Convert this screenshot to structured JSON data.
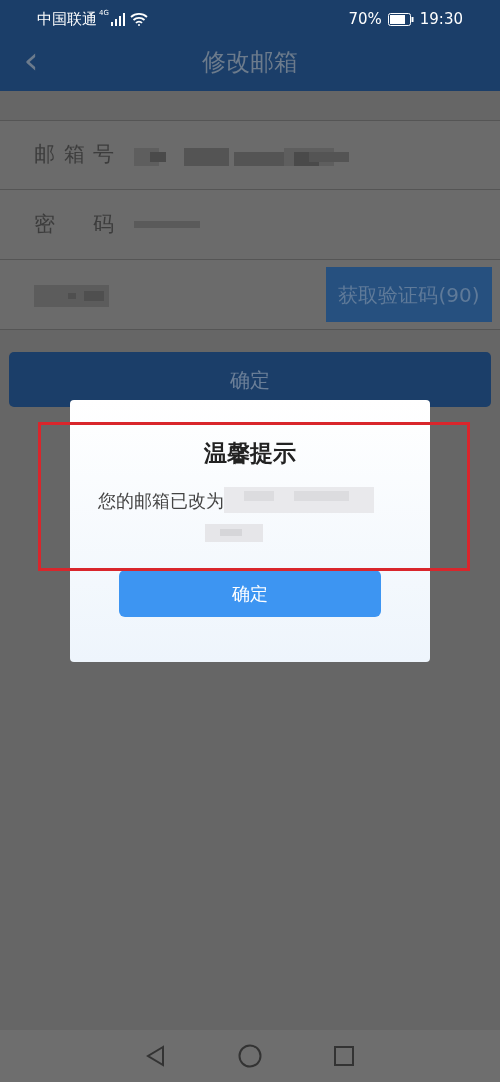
{
  "status_bar": {
    "carrier": "中国联通",
    "network": "4G",
    "battery": "70%",
    "time": "19:30"
  },
  "header": {
    "back": "‹",
    "title": "修改邮箱"
  },
  "form": {
    "rows": [
      {
        "kind": "email",
        "label": "邮箱号"
      },
      {
        "kind": "password",
        "label": "密码"
      },
      {
        "kind": "code",
        "button": "获取验证码(90)"
      }
    ],
    "submit": "确定"
  },
  "dialog": {
    "title": "温馨提示",
    "message": "您的邮箱已改为",
    "button": "确定"
  }
}
